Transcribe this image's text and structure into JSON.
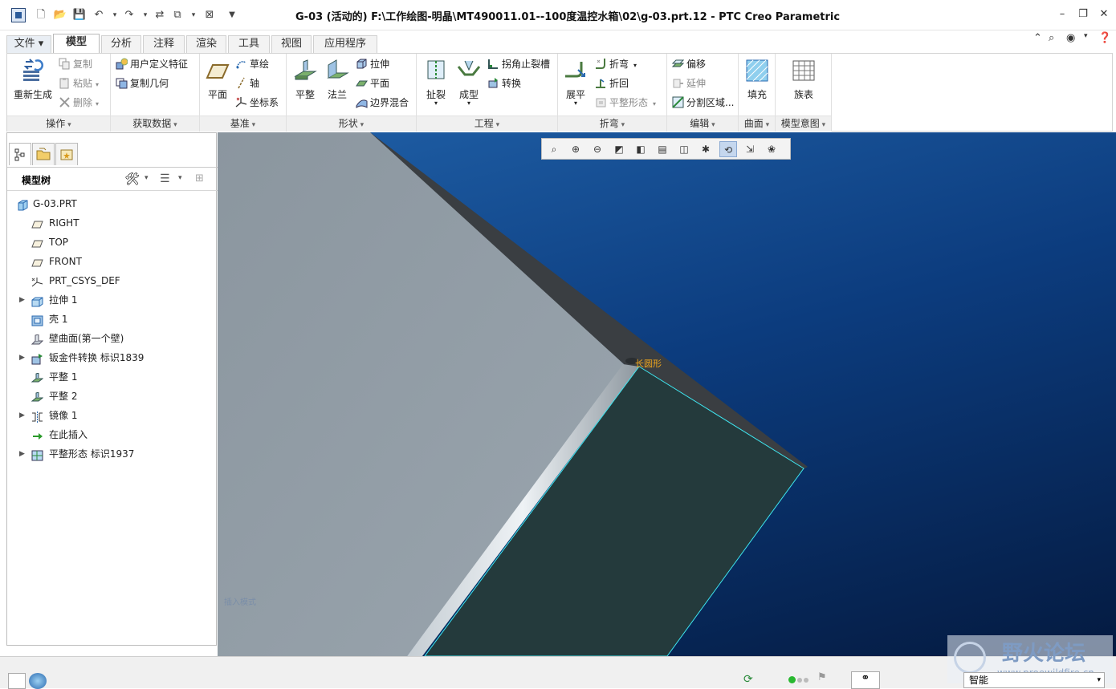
{
  "window": {
    "title": "G-03 (活动的) F:\\工作绘图-明晶\\MT490011.01--100度温控水箱\\02\\g-03.prt.12 - PTC Creo Parametric",
    "controls": [
      "–",
      "❐",
      "✕"
    ]
  },
  "menu_tabs": [
    {
      "label": "文件 ▾"
    },
    {
      "label": "模型"
    },
    {
      "label": "分析"
    },
    {
      "label": "注释"
    },
    {
      "label": "渲染"
    },
    {
      "label": "工具"
    },
    {
      "label": "视图"
    },
    {
      "label": "应用程序"
    }
  ],
  "ribbon": {
    "operations": {
      "label": "操作",
      "regen": "重新生成",
      "copy": "复制",
      "paste": "粘贴",
      "delete": "删除"
    },
    "get_data": {
      "label": "获取数据",
      "udf": "用户定义特征",
      "copy_geom": "复制几何"
    },
    "datum": {
      "label": "基准",
      "plane": "平面",
      "sketch": "草绘",
      "axis": "轴",
      "csys": "坐标系"
    },
    "shapes": {
      "label": "形状",
      "planar": "平整",
      "flange": "法兰",
      "extrude": "拉伸",
      "flat": "平面",
      "blend": "边界混合"
    },
    "engineering": {
      "label": "工程",
      "rip": "扯裂",
      "form": "成型",
      "corner_relief": "拐角止裂槽",
      "convert": "转换"
    },
    "bends": {
      "label": "折弯",
      "unbend": "展平",
      "bend": "折弯",
      "bend_back": "折回",
      "flat_state": "平整形态"
    },
    "editing": {
      "label": "编辑",
      "offset": "偏移",
      "extend": "延伸",
      "split": "分割区域..."
    },
    "surfaces": {
      "label": "曲面",
      "fill": "填充"
    },
    "model_intent": {
      "label": "模型意图",
      "family": "族表"
    }
  },
  "model_tree": {
    "title": "模型树",
    "items": [
      {
        "label": "G-03.PRT",
        "icon": "part-icon",
        "expandable": false
      },
      {
        "label": "RIGHT",
        "icon": "datum-plane-icon",
        "expandable": false
      },
      {
        "label": "TOP",
        "icon": "datum-plane-icon",
        "expandable": false
      },
      {
        "label": "FRONT",
        "icon": "datum-plane-icon",
        "expandable": false
      },
      {
        "label": "PRT_CSYS_DEF",
        "icon": "csys-icon",
        "expandable": false
      },
      {
        "label": "拉伸 1",
        "icon": "extrude-icon",
        "expandable": true
      },
      {
        "label": "壳 1",
        "icon": "shell-icon",
        "expandable": false
      },
      {
        "label": "壁曲面(第一个壁)",
        "icon": "wall-surface-icon",
        "expandable": false
      },
      {
        "label": "钣金件转换 标识1839",
        "icon": "convert-icon",
        "expandable": true
      },
      {
        "label": "平整 1",
        "icon": "planar-wall-icon",
        "expandable": false
      },
      {
        "label": "平整 2",
        "icon": "planar-wall-icon",
        "expandable": false
      },
      {
        "label": "镜像 1",
        "icon": "mirror-icon",
        "expandable": true
      },
      {
        "label": "在此插入",
        "icon": "insert-here-arrow-icon",
        "expandable": false
      },
      {
        "label": "平整形态 标识1937",
        "icon": "flat-state-icon",
        "expandable": true
      }
    ]
  },
  "viewport": {
    "annotation": "长圆形",
    "insert_mode": "插入模式",
    "colors": {
      "background_top": "#1f5fa6",
      "background_bottom": "#041a40",
      "part_face": "#8f9aa3",
      "selected_face": "#24383a",
      "highlight_edge": "#3ee6f0",
      "label": "#f2a81d"
    }
  },
  "status": {
    "filter": "智能"
  },
  "watermark": {
    "title": "野火论坛",
    "url": "www.proewildfire.cn"
  }
}
